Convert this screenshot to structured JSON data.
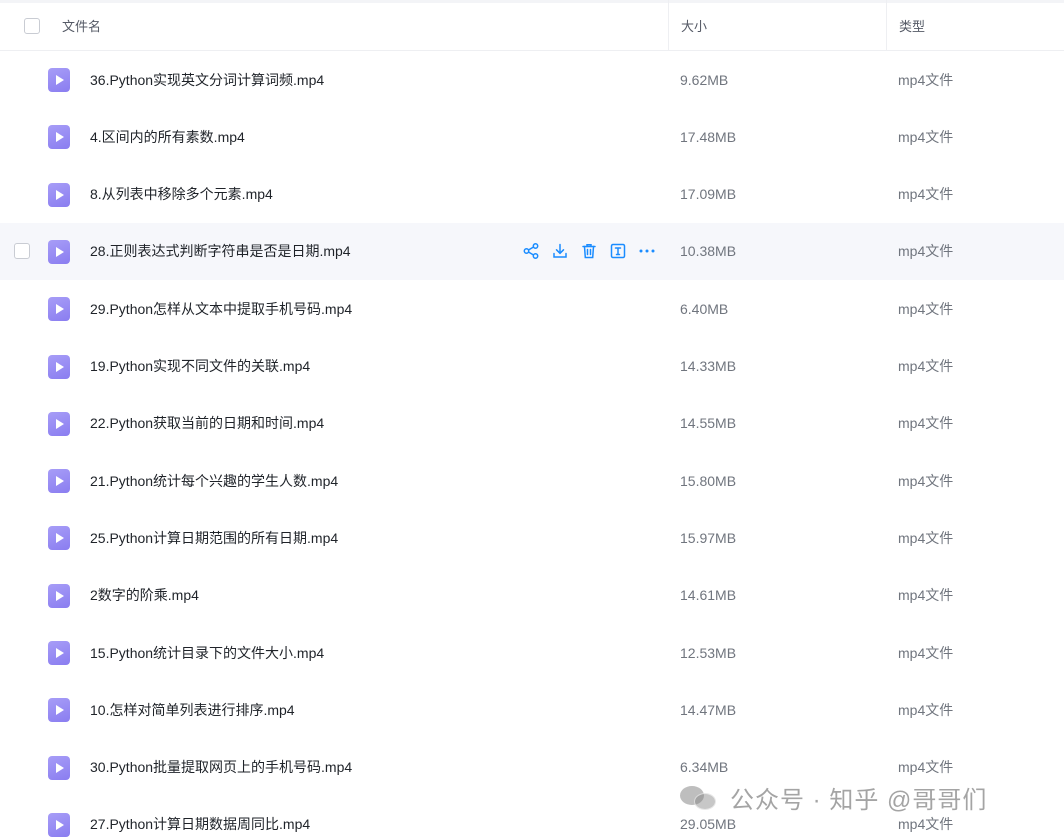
{
  "header": {
    "name_label": "文件名",
    "size_label": "大小",
    "type_label": "类型"
  },
  "files": [
    {
      "name": "36.Python实现英文分词计算词频.mp4",
      "size": "9.62MB",
      "type": "mp4文件"
    },
    {
      "name": "4.区间内的所有素数.mp4",
      "size": "17.48MB",
      "type": "mp4文件"
    },
    {
      "name": "8.从列表中移除多个元素.mp4",
      "size": "17.09MB",
      "type": "mp4文件"
    },
    {
      "name": "28.正则表达式判断字符串是否是日期.mp4",
      "size": "10.38MB",
      "type": "mp4文件"
    },
    {
      "name": "29.Python怎样从文本中提取手机号码.mp4",
      "size": "6.40MB",
      "type": "mp4文件"
    },
    {
      "name": "19.Python实现不同文件的关联.mp4",
      "size": "14.33MB",
      "type": "mp4文件"
    },
    {
      "name": "22.Python获取当前的日期和时间.mp4",
      "size": "14.55MB",
      "type": "mp4文件"
    },
    {
      "name": "21.Python统计每个兴趣的学生人数.mp4",
      "size": "15.80MB",
      "type": "mp4文件"
    },
    {
      "name": "25.Python计算日期范围的所有日期.mp4",
      "size": "15.97MB",
      "type": "mp4文件"
    },
    {
      "name": "2数字的阶乘.mp4",
      "size": "14.61MB",
      "type": "mp4文件"
    },
    {
      "name": "15.Python统计目录下的文件大小.mp4",
      "size": "12.53MB",
      "type": "mp4文件"
    },
    {
      "name": "10.怎样对简单列表进行排序.mp4",
      "size": "14.47MB",
      "type": "mp4文件"
    },
    {
      "name": "30.Python批量提取网页上的手机号码.mp4",
      "size": "6.34MB",
      "type": "mp4文件"
    },
    {
      "name": "27.Python计算日期数据周同比.mp4",
      "size": "29.05MB",
      "type": "mp4文件"
    }
  ],
  "hovered_row_index": 3,
  "row_actions": [
    "share-icon",
    "download-icon",
    "delete-icon",
    "rename-icon",
    "more-icon"
  ],
  "icon_file_type": "video-file-icon",
  "colors": {
    "accent": "#1a8cff",
    "file_icon": "#968af3",
    "hover_row": "#f6f7fb"
  },
  "watermark": {
    "text": "公众号 · 知乎 @哥哥们"
  }
}
